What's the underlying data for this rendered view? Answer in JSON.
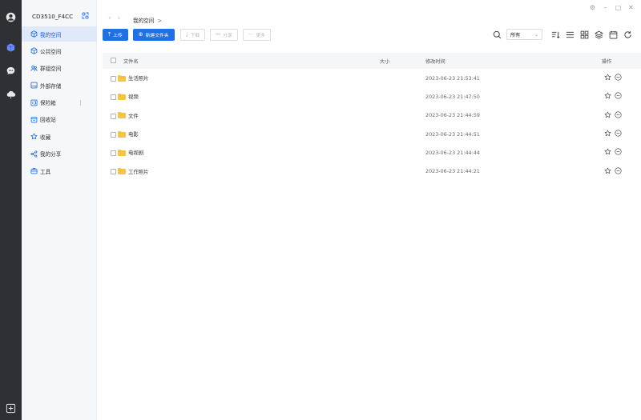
{
  "device": {
    "name": "CD3510_F4CC"
  },
  "sidebar": {
    "items": [
      {
        "label": "我的空间",
        "icon": "cube-icon",
        "active": true
      },
      {
        "label": "公共空间",
        "icon": "cube-outline-icon"
      },
      {
        "label": "群组空间",
        "icon": "group-icon"
      },
      {
        "label": "外部存储",
        "icon": "external-storage-icon"
      },
      {
        "label": "保险箱",
        "icon": "safe-icon"
      },
      {
        "label": "回收站",
        "icon": "recycle-bin-icon"
      },
      {
        "label": "收藏",
        "icon": "star-icon"
      },
      {
        "label": "我的分享",
        "icon": "share-icon"
      },
      {
        "label": "工具",
        "icon": "toolbox-icon"
      }
    ]
  },
  "breadcrumb": {
    "current": "我的空间",
    "sep": ">"
  },
  "toolbar": {
    "upload_label": "上传",
    "new_folder_label": "新建文件夹",
    "download_label": "下载",
    "share_label": "分享",
    "more_label": "更多"
  },
  "filter": {
    "selected": "所有"
  },
  "table": {
    "headers": {
      "name": "文件名",
      "size": "大小",
      "modified": "修改时间",
      "actions": "操作"
    },
    "rows": [
      {
        "name": "生活照片",
        "size": "",
        "modified": "2023-06-23 21:53:41"
      },
      {
        "name": "视频",
        "size": "",
        "modified": "2023-06-23 21:47:50"
      },
      {
        "name": "文件",
        "size": "",
        "modified": "2023-06-23 21:44:59"
      },
      {
        "name": "电影",
        "size": "",
        "modified": "2023-06-23 21:44:51"
      },
      {
        "name": "电视剧",
        "size": "",
        "modified": "2023-06-23 21:44:44"
      },
      {
        "name": "工作照片",
        "size": "",
        "modified": "2023-06-23 21:44:21"
      }
    ]
  },
  "colors": {
    "accent": "#1f6fe5",
    "rail": "#2f3033",
    "folder": "#f7c443",
    "active_bg": "#dfe9fa"
  }
}
